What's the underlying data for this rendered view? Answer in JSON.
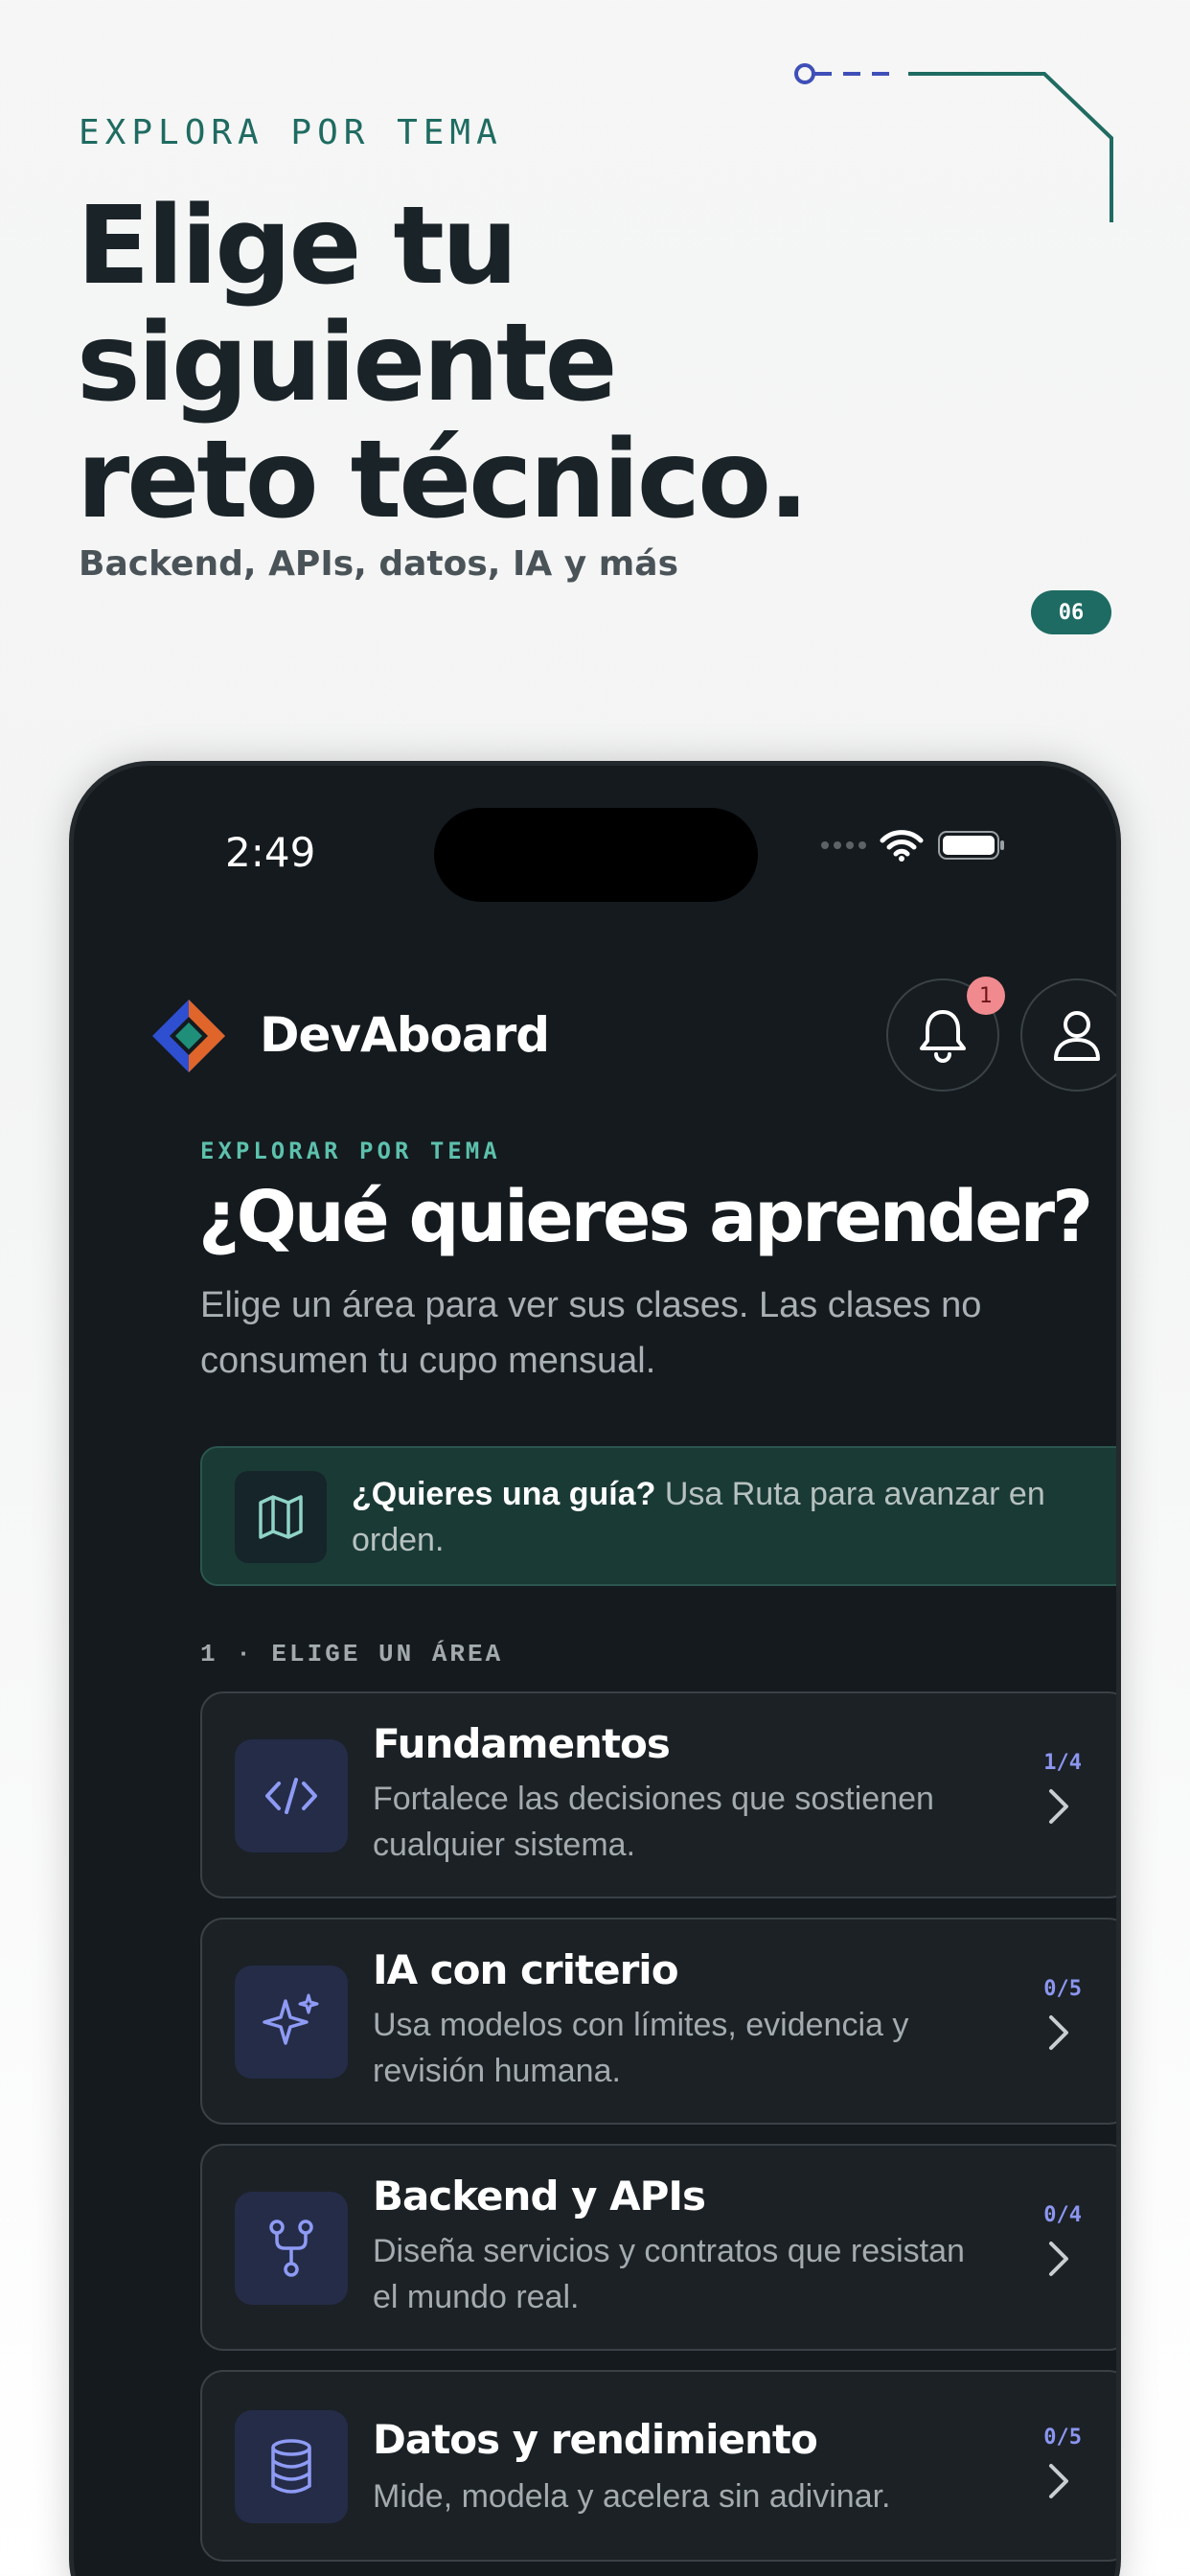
{
  "promo": {
    "eyebrow": "EXPLORA POR TEMA",
    "headline_line1": "Elige tu siguiente",
    "headline_line2": "reto técnico.",
    "subline": "Backend, APIs, datos, IA y más",
    "page_number": "06",
    "accent_color": "#1d6b62"
  },
  "status_bar": {
    "time": "2:49"
  },
  "app": {
    "brand": "DevAboard",
    "notification_count": "1",
    "explore": {
      "eyebrow": "EXPLORAR POR TEMA",
      "title": "¿Qué quieres aprender?",
      "description": "Elige un área para ver sus clases. Las clases no consumen tu cupo mensual."
    },
    "guide": {
      "bold": "¿Quieres una guía?",
      "text": " Usa Ruta para avanzar en orden.",
      "icon": "map-icon"
    },
    "step_label": "1 · ELIGE UN ÁREA",
    "areas": [
      {
        "title": "Fundamentos",
        "description": "Fortalece las decisiones que sostienen cualquier sistema.",
        "progress": "1/4",
        "icon": "code-icon"
      },
      {
        "title": "IA con criterio",
        "description": "Usa modelos con límites, evidencia y revisión humana.",
        "progress": "0/5",
        "icon": "sparkles-icon"
      },
      {
        "title": "Backend y APIs",
        "description": "Diseña servicios y contratos que resistan el mundo real.",
        "progress": "0/4",
        "icon": "git-fork-icon"
      },
      {
        "title": "Datos y rendimiento",
        "description": "Mide, modela y acelera sin adivinar.",
        "progress": "0/5",
        "icon": "database-icon"
      }
    ]
  }
}
